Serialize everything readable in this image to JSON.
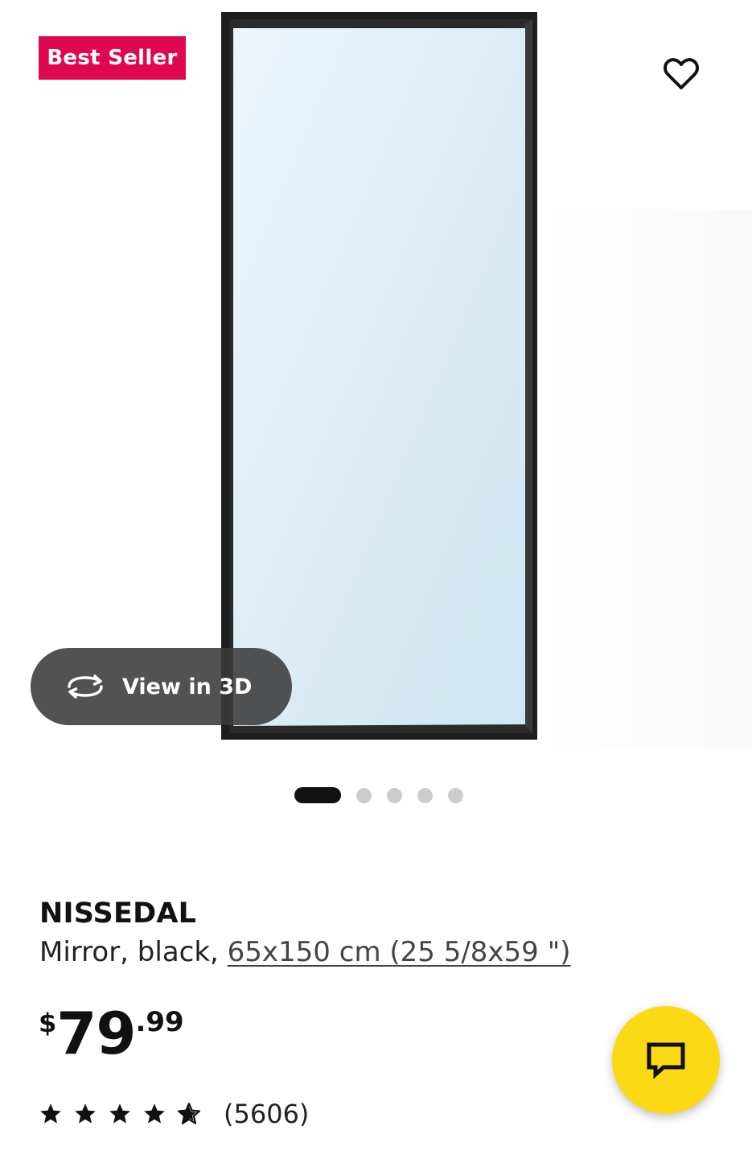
{
  "gallery": {
    "badge_label": "Best Seller",
    "view3d_label": "View in 3D",
    "image_count": 5,
    "active_image": 1
  },
  "product": {
    "name": "NISSEDAL",
    "description_prefix": "Mirror, black, ",
    "size_link": "65x150 cm (25 5/8x59 \")",
    "price": {
      "currency": "$",
      "integer": "79",
      "decimal": ".99"
    },
    "rating": {
      "stars": 4.5,
      "count_label": "(5606)"
    }
  },
  "colors": {
    "badge": "#e00751",
    "chat_button": "#fbd914",
    "mirror_frame": "#1e1e1e",
    "mirror_glass": "#d9ecf5"
  },
  "icons": {
    "favorite": "heart-outline-icon",
    "view3d": "rotate-3d-icon",
    "chat": "chat-bubble-icon",
    "rating": "star-icon"
  }
}
